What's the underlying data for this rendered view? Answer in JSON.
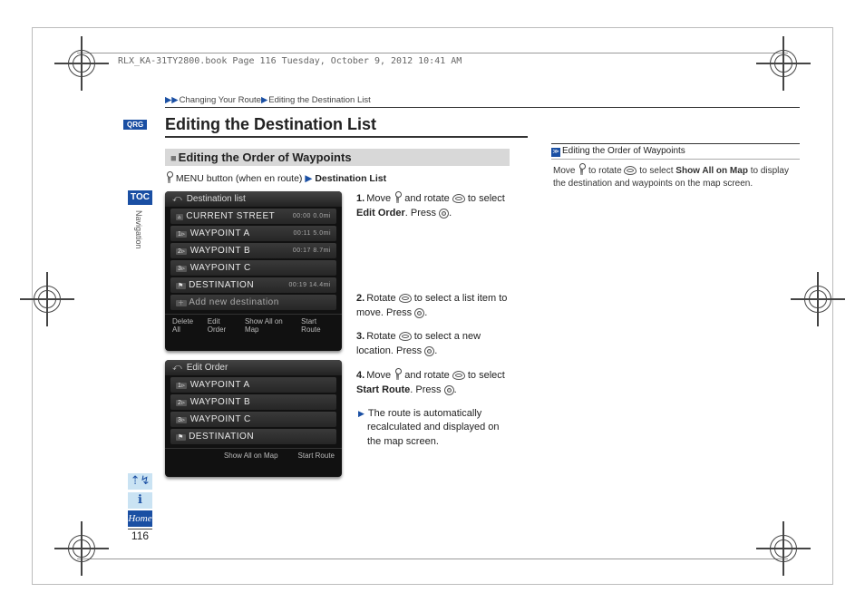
{
  "book_header": "RLX_KA-31TY2800.book  Page 116  Tuesday, October 9, 2012  10:41 AM",
  "breadcrumb": {
    "a": "Changing Your Route",
    "b": "Editing the Destination List"
  },
  "qrg": "QRG",
  "title": "Editing the Destination List",
  "section": "Editing the Order of Waypoints",
  "menupath": {
    "lead": "MENU button (when en route)",
    "dest": "Destination List"
  },
  "toc": "TOC",
  "nav_label": "Navigation",
  "home": "Home",
  "page_num": "116",
  "device1": {
    "header": "Destination list",
    "rows": [
      {
        "tag": "▵",
        "label": "CURRENT STREET",
        "info": "00:00   0.0mi"
      },
      {
        "tag": "1▹",
        "label": "WAYPOINT A",
        "info": "00:11   5.0mi"
      },
      {
        "tag": "2▹",
        "label": "WAYPOINT B",
        "info": "00:17   8.7mi"
      },
      {
        "tag": "3▹",
        "label": "WAYPOINT C",
        "info": ""
      },
      {
        "tag": "⚑",
        "label": "DESTINATION",
        "info": "00:19  14.4mi"
      },
      {
        "tag": "＋",
        "label": "Add new destination",
        "info": ""
      }
    ],
    "foot": [
      "Delete All",
      "Edit Order",
      "Show All on Map",
      "Start Route"
    ]
  },
  "device2": {
    "header": "Edit Order",
    "rows": [
      {
        "tag": "1▹",
        "label": "WAYPOINT A"
      },
      {
        "tag": "2▹",
        "label": "WAYPOINT B"
      },
      {
        "tag": "3▹",
        "label": "WAYPOINT C"
      },
      {
        "tag": "⚑",
        "label": "DESTINATION"
      }
    ],
    "foot": [
      "Show All on Map",
      "Start Route"
    ]
  },
  "steps": {
    "s1a": "Move ",
    "s1b": " and rotate ",
    "s1c": " to select ",
    "s1bold": "Edit Order",
    "s1d": ". Press ",
    "s1e": ".",
    "s2a": "Rotate ",
    "s2b": " to select a list item to move. Press ",
    "s2c": ".",
    "s3a": "Rotate ",
    "s3b": " to select a new location. Press ",
    "s3c": ".",
    "s4a": "Move ",
    "s4b": " and rotate ",
    "s4c": " to select ",
    "s4bold": "Start Route",
    "s4d": ". Press ",
    "s4e": ".",
    "sub": "The route is automatically recalculated and displayed on the map screen."
  },
  "note": {
    "head": "Editing the Order of Waypoints",
    "b1": "Move ",
    "b2": " to rotate ",
    "b3": " to select ",
    "bold": "Show All on Map",
    "b4": " to display the destination and waypoints on the map screen."
  }
}
